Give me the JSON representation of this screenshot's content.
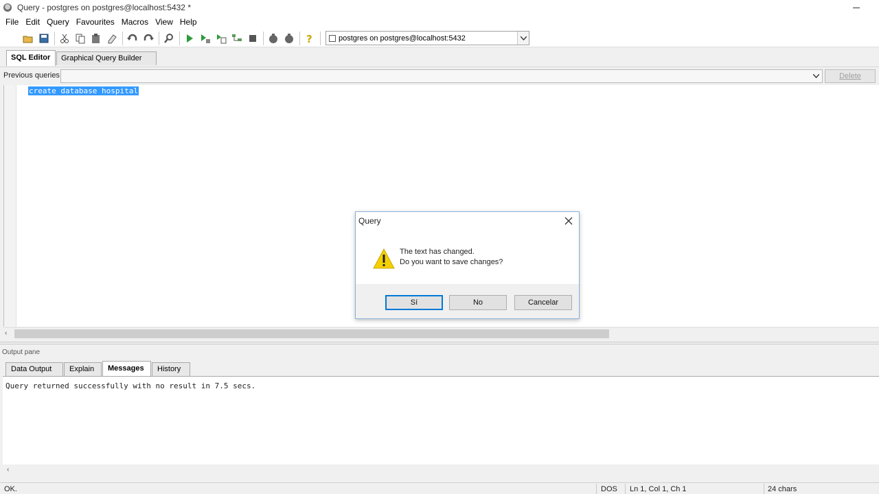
{
  "window": {
    "title": "Query - postgres on postgres@localhost:5432 *"
  },
  "menubar": {
    "items": [
      "File",
      "Edit",
      "Query",
      "Favourites",
      "Macros",
      "View",
      "Help"
    ]
  },
  "toolbar": {
    "buttons": [
      "open-file-icon",
      "save-icon",
      "cut-icon",
      "copy-icon",
      "paste-icon",
      "clear-icon",
      "undo-icon",
      "redo-icon",
      "find-icon",
      "execute-icon",
      "execute-pgscript-icon",
      "execute-to-file-icon",
      "explain-icon",
      "stop-icon",
      "vacuum-icon",
      "analyze-icon",
      "help-icon"
    ],
    "connection": "postgres on postgres@localhost:5432"
  },
  "editor_tabs": [
    "SQL Editor",
    "Graphical Query Builder"
  ],
  "previous_queries": {
    "label": "Previous queries",
    "delete_label": "Delete"
  },
  "editor": {
    "code": "create database hospital"
  },
  "output": {
    "title": "Output pane",
    "tabs": [
      "Data Output",
      "Explain",
      "Messages",
      "History"
    ],
    "active_tab": "Messages",
    "message": "Query returned successfully with no result in 7.5 secs."
  },
  "status": {
    "state": "OK.",
    "eol": "DOS",
    "position": "Ln 1, Col 1, Ch 1",
    "chars": "24 chars"
  },
  "dialog": {
    "title": "Query",
    "line1": "The text has changed.",
    "line2": "Do you want to save changes?",
    "buttons": {
      "yes": "Sí",
      "no": "No",
      "cancel": "Cancelar"
    }
  },
  "colors": {
    "selection": "#3399ff",
    "dialog_border": "#8ab0d8",
    "default_button": "#0078d7"
  }
}
